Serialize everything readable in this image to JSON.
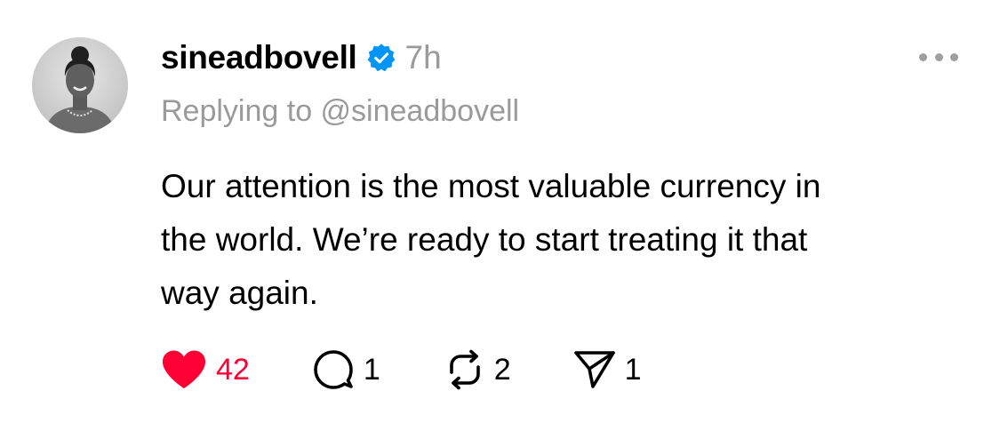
{
  "post": {
    "username": "sineadbovell",
    "time": "7h",
    "replying_to": "Replying to @sineadbovell",
    "text_lines": [
      "Our attention is the most valuable currency in",
      "the world. We’re ready to start treating it that",
      "way again."
    ]
  },
  "actions": {
    "like_count": "42",
    "reply_count": "1",
    "repost_count": "2",
    "share_count": "1"
  },
  "icons": {
    "verified": "verified-badge-icon",
    "more": "more-horizontal-icon",
    "like": "heart-filled-icon",
    "reply": "comment-icon",
    "repost": "repost-icon",
    "share": "send-icon"
  },
  "colors": {
    "like": "#ff0034",
    "verified": "#0095f6",
    "muted": "#9a9a9a"
  }
}
